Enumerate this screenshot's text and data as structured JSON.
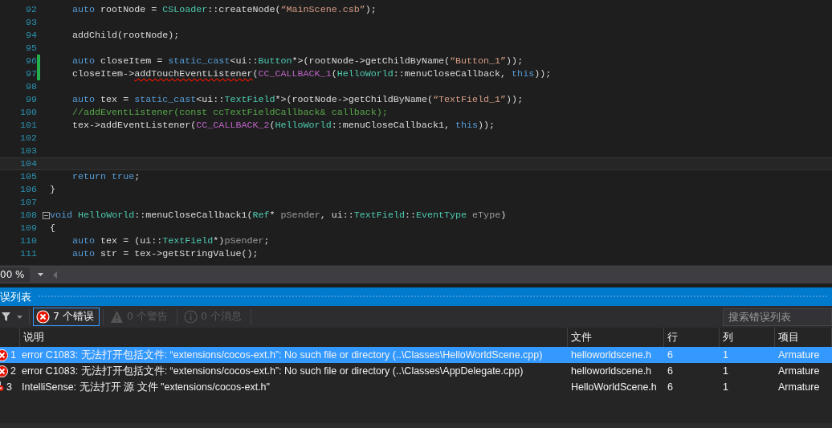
{
  "editor": {
    "lines": [
      {
        "number": "92",
        "indent": true,
        "tokens": [
          {
            "kind": "kw",
            "text": "auto"
          },
          {
            "kind": "plain",
            "text": " rootNode = "
          },
          {
            "kind": "type",
            "text": "CSLoader"
          },
          {
            "kind": "plain",
            "text": "::createNode("
          },
          {
            "kind": "str",
            "text": "“MainScene.csb”"
          },
          {
            "kind": "plain",
            "text": ");"
          }
        ]
      },
      {
        "number": "93"
      },
      {
        "number": "94",
        "indent": true,
        "tokens": [
          {
            "kind": "plain",
            "text": "addChild(rootNode);"
          }
        ]
      },
      {
        "number": "95"
      },
      {
        "number": "96",
        "changed": true,
        "indent": true,
        "tokens": [
          {
            "kind": "kw",
            "text": "auto"
          },
          {
            "kind": "plain",
            "text": " closeItem = "
          },
          {
            "kind": "kw",
            "text": "static_cast"
          },
          {
            "kind": "plain",
            "text": "<ui::"
          },
          {
            "kind": "type",
            "text": "Button"
          },
          {
            "kind": "plain",
            "text": "*>(rootNode->getChildByName("
          },
          {
            "kind": "str",
            "text": "“Button_1”"
          },
          {
            "kind": "plain",
            "text": "));"
          }
        ]
      },
      {
        "number": "97",
        "changed": true,
        "indent": true,
        "tokens": [
          {
            "kind": "plain",
            "text": "closeItem->"
          },
          {
            "kind": "squiggle",
            "text": "addTouchEventListener"
          },
          {
            "kind": "plain",
            "text": "("
          },
          {
            "kind": "macro",
            "text": "CC_CALLBACK_1"
          },
          {
            "kind": "plain",
            "text": "("
          },
          {
            "kind": "type",
            "text": "HelloWorld"
          },
          {
            "kind": "plain",
            "text": "::menuCloseCallback, "
          },
          {
            "kind": "kw",
            "text": "this"
          },
          {
            "kind": "plain",
            "text": "));"
          }
        ]
      },
      {
        "number": "98"
      },
      {
        "number": "99",
        "indent": true,
        "tokens": [
          {
            "kind": "kw",
            "text": "auto"
          },
          {
            "kind": "plain",
            "text": " tex = "
          },
          {
            "kind": "kw",
            "text": "static_cast"
          },
          {
            "kind": "plain",
            "text": "<ui::"
          },
          {
            "kind": "type",
            "text": "TextField"
          },
          {
            "kind": "plain",
            "text": "*>(rootNode->getChildByName("
          },
          {
            "kind": "str",
            "text": "“TextField_1”"
          },
          {
            "kind": "plain",
            "text": "));"
          }
        ]
      },
      {
        "number": "100",
        "indent": true,
        "tokens": [
          {
            "kind": "comment",
            "text": "//addEventListener(const ccTextFieldCallback& callback);"
          }
        ]
      },
      {
        "number": "101",
        "indent": true,
        "tokens": [
          {
            "kind": "plain",
            "text": "tex->addEventListener("
          },
          {
            "kind": "macro",
            "text": "CC_CALLBACK_2"
          },
          {
            "kind": "plain",
            "text": "("
          },
          {
            "kind": "type",
            "text": "HelloWorld"
          },
          {
            "kind": "plain",
            "text": "::menuCloseCallback1, "
          },
          {
            "kind": "kw",
            "text": "this"
          },
          {
            "kind": "plain",
            "text": "));"
          }
        ]
      },
      {
        "number": "102"
      },
      {
        "number": "103"
      },
      {
        "number": "104",
        "current": true
      },
      {
        "number": "105",
        "indent": true,
        "tokens": [
          {
            "kind": "kw",
            "text": "return "
          },
          {
            "kind": "kw",
            "text": "true"
          },
          {
            "kind": "plain",
            "text": ";"
          }
        ]
      },
      {
        "number": "106",
        "tokens": [
          {
            "kind": "plain",
            "text": "}"
          }
        ]
      },
      {
        "number": "107"
      },
      {
        "number": "108",
        "fold": true,
        "tokens": [
          {
            "kind": "kw",
            "text": "void "
          },
          {
            "kind": "type",
            "text": "HelloWorld"
          },
          {
            "kind": "plain",
            "text": "::menuCloseCallback1("
          },
          {
            "kind": "type",
            "text": "Ref"
          },
          {
            "kind": "plain",
            "text": "* "
          },
          {
            "kind": "param",
            "text": "pSender"
          },
          {
            "kind": "plain",
            "text": ", ui::"
          },
          {
            "kind": "type",
            "text": "TextField"
          },
          {
            "kind": "plain",
            "text": "::"
          },
          {
            "kind": "type",
            "text": "EventType"
          },
          {
            "kind": "param",
            "text": " eType"
          },
          {
            "kind": "plain",
            "text": ")"
          }
        ]
      },
      {
        "number": "109",
        "tokens": [
          {
            "kind": "plain",
            "text": "{"
          }
        ]
      },
      {
        "number": "110",
        "indent": true,
        "tokens": [
          {
            "kind": "kw",
            "text": "auto"
          },
          {
            "kind": "plain",
            "text": " tex = (ui::"
          },
          {
            "kind": "type",
            "text": "TextField"
          },
          {
            "kind": "plain",
            "text": "*)"
          },
          {
            "kind": "param",
            "text": "pSender"
          },
          {
            "kind": "plain",
            "text": ";"
          }
        ]
      },
      {
        "number": "111",
        "indent": true,
        "tokens": [
          {
            "kind": "kw",
            "text": "auto"
          },
          {
            "kind": "plain",
            "text": " str = tex->getStringValue();"
          }
        ]
      }
    ],
    "zoom": "00 %"
  },
  "error_list": {
    "title": "误列表",
    "filters": [
      {
        "kind": "error",
        "label": "7 个错误",
        "selected": true,
        "disabled": false
      },
      {
        "kind": "warning",
        "label": "0 个警告",
        "selected": false,
        "disabled": true
      },
      {
        "kind": "message",
        "label": "0 个消息",
        "selected": false,
        "disabled": true
      }
    ],
    "search": {
      "placeholder": "搜索错误列表"
    },
    "columns": [
      "说明",
      "文件",
      "行",
      "列",
      "项目"
    ],
    "rows": [
      {
        "kind": "error",
        "index": "1",
        "description": "error C1083: 无法打开包括文件: “extensions/cocos-ext.h”: No such file or directory (..\\Classes\\HelloWorldScene.cpp)",
        "file": "helloworldscene.h",
        "line": "6",
        "column": "1",
        "project": "Armature",
        "selected": true
      },
      {
        "kind": "error",
        "index": "2",
        "description": "error C1083: 无法打开包括文件: “extensions/cocos-ext.h”: No such file or directory (..\\Classes\\AppDelegate.cpp)",
        "file": "helloworldscene.h",
        "line": "6",
        "column": "1",
        "project": "Armature",
        "selected": false
      },
      {
        "kind": "intellisense",
        "index": "3",
        "description": "IntelliSense:  无法打开 源 文件 \"extensions/cocos-ext.h\"",
        "file": "HelloWorldScene.h",
        "line": "6",
        "column": "1",
        "project": "Armature",
        "selected": false
      }
    ]
  }
}
